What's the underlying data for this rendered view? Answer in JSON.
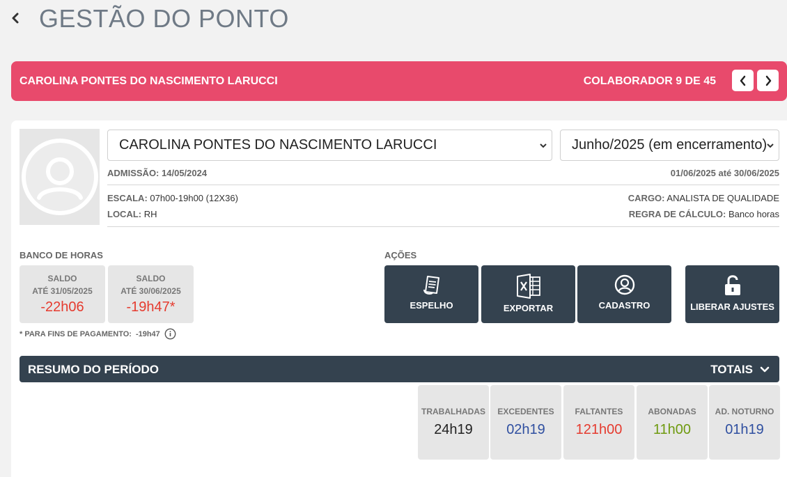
{
  "header": {
    "title": "GESTÃO DO PONTO"
  },
  "banner": {
    "employee_name": "CAROLINA PONTES DO NASCIMENTO LARUCCI",
    "counter": "COLABORADOR 9 DE 45"
  },
  "employee": {
    "selected": "CAROLINA PONTES DO NASCIMENTO LARUCCI",
    "period_selected": "Junho/2025 (em encerramento)",
    "admissao_label": "ADMISSÃO:",
    "admissao_value": "14/05/2024",
    "period_start": "01/06/2025",
    "period_sep": "até",
    "period_end": "30/06/2025",
    "escala_label": "ESCALA:",
    "escala_value": "07h00-19h00 (12X36)",
    "local_label": "LOCAL:",
    "local_value": "RH",
    "cargo_label": "CARGO:",
    "cargo_value": "ANALISTA DE QUALIDADE",
    "regra_label": "REGRA DE CÁLCULO:",
    "regra_value": "Banco horas"
  },
  "banco": {
    "title": "BANCO DE HORAS",
    "saldos": [
      {
        "line1": "SALDO",
        "line2": "ATÉ 31/05/2025",
        "value": "-22h06"
      },
      {
        "line1": "SALDO",
        "line2": "ATÉ 30/06/2025",
        "value": "-19h47*"
      }
    ],
    "note_label": "* PARA FINS DE PAGAMENTO:",
    "note_value": "-19h47"
  },
  "acoes": {
    "title": "AÇÕES",
    "items": [
      {
        "label": "ESPELHO",
        "icon": "document-icon"
      },
      {
        "label": "EXPORTAR",
        "icon": "excel-icon"
      },
      {
        "label": "CADASTRO",
        "icon": "user-circle-icon"
      },
      {
        "label": "LIBERAR AJUSTES",
        "icon": "unlock-icon"
      }
    ]
  },
  "resumo": {
    "title": "RESUMO DO PERÍODO",
    "totais_label": "TOTAIS",
    "totals": [
      {
        "label": "TRABALHADAS",
        "value": "24h19",
        "color": "#222222"
      },
      {
        "label": "EXCEDENTES",
        "value": "02h19",
        "color": "#2f4fa0"
      },
      {
        "label": "FALTANTES",
        "value": "121h00",
        "color": "#e53b2f"
      },
      {
        "label": "ABONADAS",
        "value": "11h00",
        "color": "#6e9a0f"
      },
      {
        "label": "AD. NOTURNO",
        "value": "01h19",
        "color": "#2f4fa0"
      }
    ]
  },
  "colors": {
    "banner": "#e84a6c",
    "dark": "#34424f",
    "negative": "#e53b2f"
  }
}
